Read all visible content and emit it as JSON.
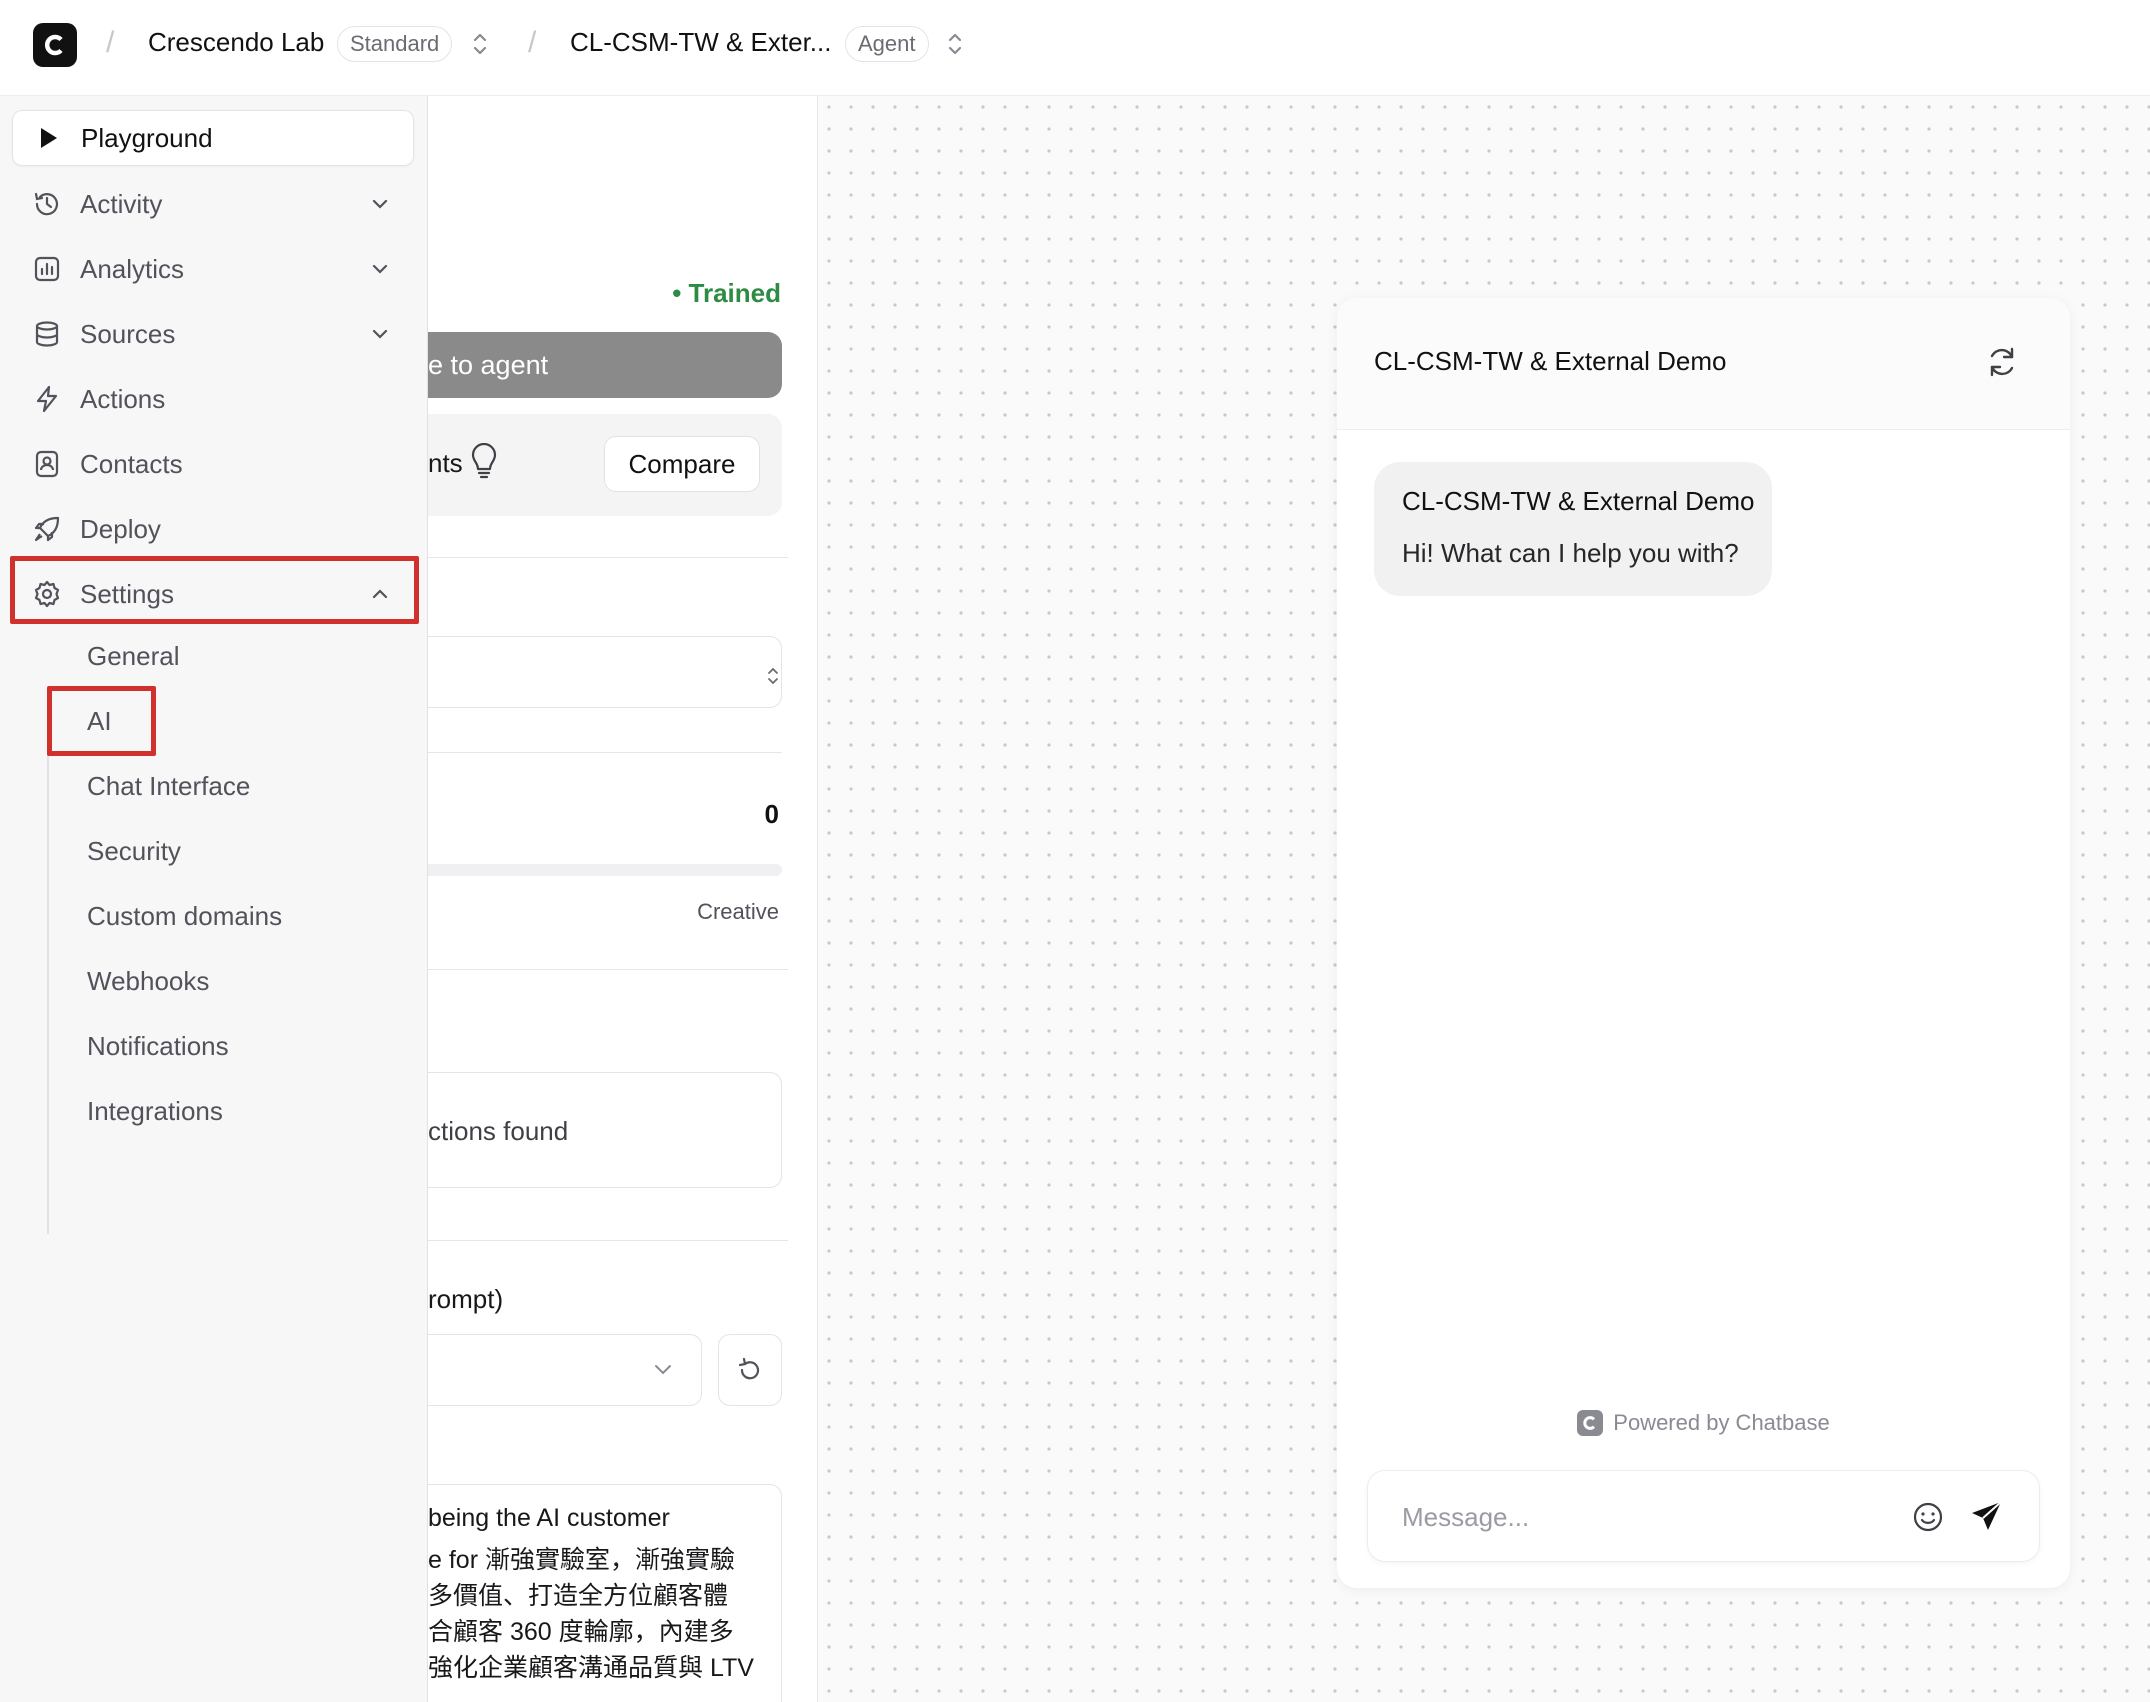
{
  "topbar": {
    "logo_letter": "C",
    "workspace_name": "Crescendo Lab",
    "workspace_plan": "Standard",
    "agent_name": "CL-CSM-TW & Exter...",
    "agent_badge": "Agent",
    "separator": "/"
  },
  "sidebar": {
    "items": [
      {
        "label": "Playground",
        "icon": "play-icon"
      },
      {
        "label": "Activity",
        "icon": "history-icon"
      },
      {
        "label": "Analytics",
        "icon": "bar-chart-icon"
      },
      {
        "label": "Sources",
        "icon": "database-icon"
      },
      {
        "label": "Actions",
        "icon": "lightning-icon"
      },
      {
        "label": "Contacts",
        "icon": "contact-icon"
      },
      {
        "label": "Deploy",
        "icon": "rocket-icon"
      },
      {
        "label": "Settings",
        "icon": "gear-icon"
      }
    ],
    "settings_sub": [
      "General",
      "AI",
      "Chat Interface",
      "Security",
      "Custom domains",
      "Webhooks",
      "Notifications",
      "Integrations"
    ],
    "highlight_color": "#d0312d"
  },
  "middle": {
    "status": "• Trained",
    "save_button": "e to agent",
    "compare_text": "nts",
    "compare_button": "Compare",
    "temperature_value": "0",
    "temperature_max_label": "Creative",
    "actions_empty": "ctions found",
    "prompt_label": "rompt)",
    "instructions_lines": [
      "being the AI customer",
      "e for 漸強實驗室，漸強實驗",
      "多價值、打造全方位顧客體",
      "合顧客 360 度輪廓，內建多",
      "強化企業顧客溝通品質與 LTV"
    ],
    "status_color": "#2e8b43"
  },
  "chat": {
    "title": "CL-CSM-TW & External Demo",
    "bubble_name": "CL-CSM-TW & External Demo",
    "bubble_message": "Hi! What can I help you with?",
    "powered_by": "Powered by Chatbase",
    "input_placeholder": "Message..."
  }
}
